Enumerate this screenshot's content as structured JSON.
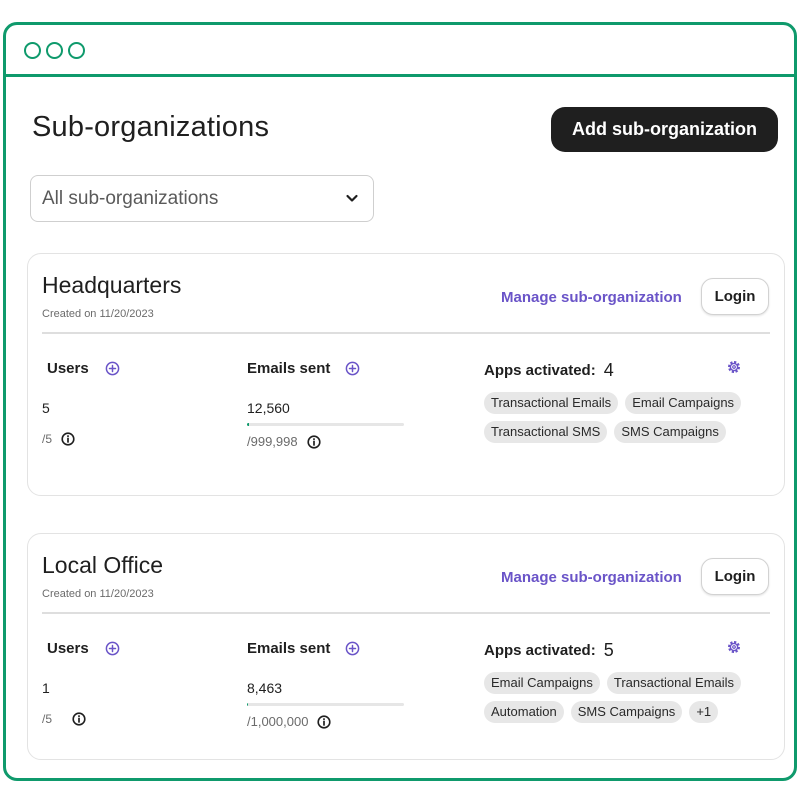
{
  "page": {
    "title": "Sub-organizations",
    "add_button": "Add sub-organization",
    "filter": {
      "selected": "All sub-organizations"
    }
  },
  "colors": {
    "accent": "#0f9a6c",
    "link": "#6a54c8",
    "primary_button": "#1f1f1f"
  },
  "labels": {
    "manage": "Manage sub-organization",
    "login": "Login",
    "users": "Users",
    "emails_sent": "Emails sent",
    "apps_activated": "Apps activated:"
  },
  "orgs": [
    {
      "name": "Headquarters",
      "created": "Created on 11/20/2023",
      "users": "5",
      "users_limit": "/5",
      "emails": "12,560",
      "emails_limit": "/999,998",
      "emails_fraction": 0.0126,
      "apps_count": "4",
      "apps": [
        "Transactional Emails",
        "Email Campaigns",
        "Transactional SMS",
        "SMS Campaigns"
      ]
    },
    {
      "name": "Local Office",
      "created": "Created on 11/20/2023",
      "users": "1",
      "users_limit": "/5",
      "emails": "8,463",
      "emails_limit": "/1,000,000",
      "emails_fraction": 0.0085,
      "apps_count": "5",
      "apps": [
        "Email Campaigns",
        "Transactional Emails",
        "Automation",
        "SMS Campaigns",
        "+1"
      ]
    }
  ]
}
